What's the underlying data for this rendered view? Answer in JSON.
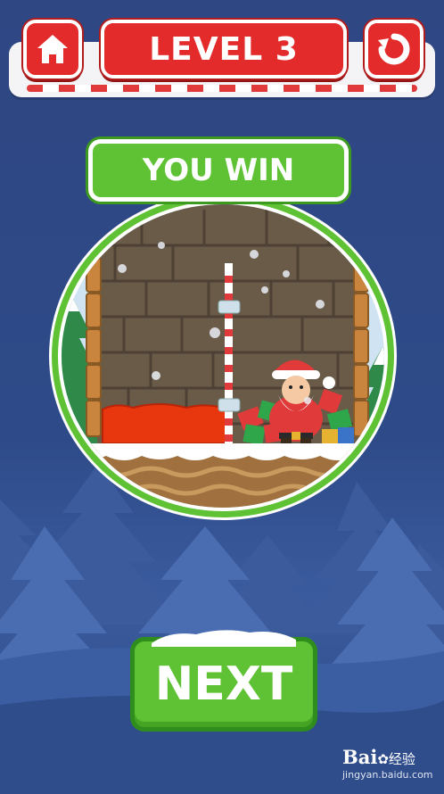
{
  "header": {
    "level_label": "LEVEL 3",
    "home_icon": "home-icon",
    "restart_icon": "restart-icon"
  },
  "result": {
    "title": "YOU WIN"
  },
  "next_button": {
    "label": "NEXT"
  },
  "watermark": {
    "brand": "Bai",
    "brand_suffix": "经验",
    "url": "jingyan.baidu.com"
  },
  "colors": {
    "background": "#2e4a86",
    "level_red": "#e32b2b",
    "win_green": "#5fc234",
    "lava": "#e8360f"
  }
}
